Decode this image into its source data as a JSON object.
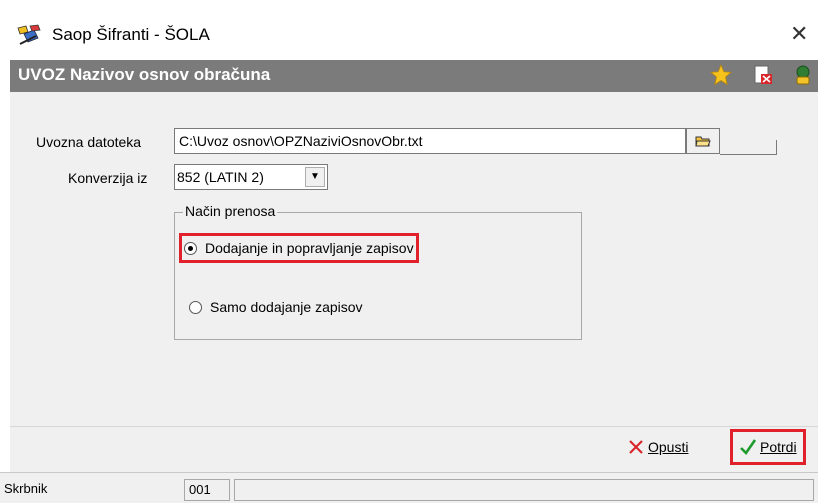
{
  "window": {
    "title": "Saop Šifranti - ŠOLA",
    "close_symbol": "✕"
  },
  "header": {
    "title": "UVOZ Nazivov osnov obračuna",
    "icons": [
      "star-icon",
      "delete-file-icon",
      "help-person-icon"
    ]
  },
  "form": {
    "file_label": "Uvozna datoteka",
    "file_value": "C:\\Uvoz osnov\\OPZNaziviOsnovObr.txt",
    "conversion_label": "Konverzija iz",
    "conversion_value": "852 (LATIN 2)"
  },
  "transfer_mode": {
    "title": "Način prenosa",
    "options": [
      {
        "label": "Dodajanje in popravljanje zapisov",
        "selected": true
      },
      {
        "label": "Samo dodajanje zapisov",
        "selected": false
      }
    ]
  },
  "actions": {
    "cancel_label": "Opusti",
    "confirm_label": "Potrdi"
  },
  "status": {
    "user": "Skrbnik",
    "code": "001"
  },
  "colors": {
    "header_bg": "#7b7b7b",
    "highlight": "#e0202a",
    "cancel_icon": "#d9262b",
    "confirm_icon": "#1e9b2c"
  }
}
